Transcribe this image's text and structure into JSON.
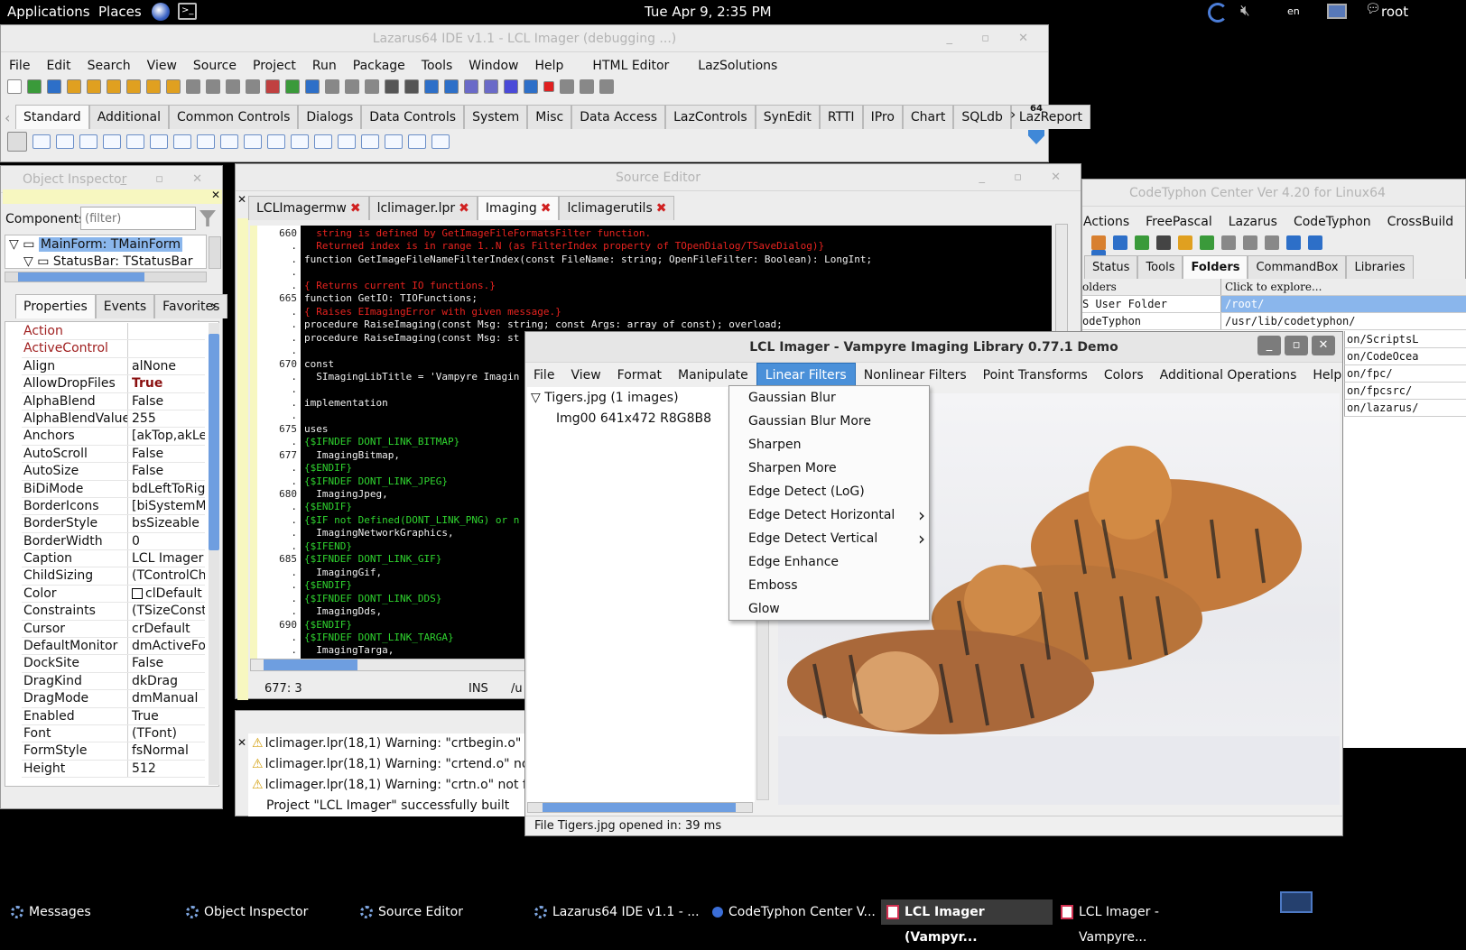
{
  "top_panel": {
    "applications": "Applications",
    "places": "Places",
    "clock": "Tue Apr  9,  2:35 PM",
    "lang": "en",
    "user": "root"
  },
  "ide": {
    "title": "Lazarus64 IDE v1.1 - LCL Imager (debugging ...)",
    "menu": [
      "File",
      "Edit",
      "Search",
      "View",
      "Source",
      "Project",
      "Run",
      "Package",
      "Tools",
      "Window",
      "Help",
      "HTML Editor",
      "LazSolutions"
    ],
    "palette_tabs": [
      "Standard",
      "Additional",
      "Common Controls",
      "Dialogs",
      "Data Controls",
      "System",
      "Misc",
      "Data Access",
      "LazControls",
      "SynEdit",
      "RTTI",
      "IPro",
      "Chart",
      "SQLdb",
      "LazReport"
    ],
    "badge": "64"
  },
  "oi": {
    "title": "Object Inspector",
    "components_label": "Components",
    "filter_placeholder": "(filter)",
    "tree": [
      "MainForm: TMainForm",
      "StatusBar: TStatusBar"
    ],
    "tabs": [
      "Properties",
      "Events",
      "Favorites"
    ],
    "props": [
      {
        "n": "Action",
        "v": "",
        "red": true
      },
      {
        "n": "ActiveControl",
        "v": "",
        "red": true
      },
      {
        "n": "Align",
        "v": "alNone"
      },
      {
        "n": "AllowDropFiles",
        "v": "True",
        "bold": true
      },
      {
        "n": "AlphaBlend",
        "v": "False"
      },
      {
        "n": "AlphaBlendValue",
        "v": "255"
      },
      {
        "n": "Anchors",
        "v": "[akTop,akLef",
        "exp": true
      },
      {
        "n": "AutoScroll",
        "v": "False"
      },
      {
        "n": "AutoSize",
        "v": "False"
      },
      {
        "n": "BiDiMode",
        "v": "bdLeftToRigh"
      },
      {
        "n": "BorderIcons",
        "v": "[biSystemMe",
        "exp": true
      },
      {
        "n": "BorderStyle",
        "v": "bsSizeable"
      },
      {
        "n": "BorderWidth",
        "v": "0"
      },
      {
        "n": "Caption",
        "v": "LCL Imager ("
      },
      {
        "n": "ChildSizing",
        "v": "(TControlCh",
        "exp": true
      },
      {
        "n": "Color",
        "v": "clDefault",
        "swatch": true
      },
      {
        "n": "Constraints",
        "v": "(TSizeConstr",
        "exp": true
      },
      {
        "n": "Cursor",
        "v": "crDefault"
      },
      {
        "n": "DefaultMonitor",
        "v": "dmActiveFor"
      },
      {
        "n": "DockSite",
        "v": "False"
      },
      {
        "n": "DragKind",
        "v": "dkDrag"
      },
      {
        "n": "DragMode",
        "v": "dmManual"
      },
      {
        "n": "Enabled",
        "v": "True"
      },
      {
        "n": "Font",
        "v": "(TFont)",
        "exp": true
      },
      {
        "n": "FormStyle",
        "v": "fsNormal"
      },
      {
        "n": "Height",
        "v": "512"
      }
    ]
  },
  "src": {
    "title": "Source Editor",
    "tabs": [
      "LCLImagermw",
      "lclimager.lpr",
      "Imaging",
      "lclimagerutils"
    ],
    "status": {
      "pos": "677:  3",
      "mode": "INS",
      "path": "/u"
    },
    "lines": [
      {
        "ln": "660",
        "t": "  string is defined by GetImageFileFormatsFilter function.",
        "c": "#e8231f"
      },
      {
        "ln": ".",
        "t": "  Returned index is in range 1..N (as FilterIndex property of TOpenDialog/TSaveDialog)}",
        "c": "#e8231f"
      },
      {
        "ln": ".",
        "t": "function GetImageFileNameFilterIndex(const FileName: string; OpenFileFilter: Boolean): LongInt;",
        "c": "#f0f0f0"
      },
      {
        "ln": ".",
        "t": "",
        "c": "#fff"
      },
      {
        "ln": ".",
        "t": "{ Returns current IO functions.}",
        "c": "#e8231f"
      },
      {
        "ln": "665",
        "t": "function GetIO: TIOFunctions;",
        "c": "#f0f0f0"
      },
      {
        "ln": ".",
        "t": "{ Raises EImagingError with given message.}",
        "c": "#e8231f"
      },
      {
        "ln": ".",
        "t": "procedure RaiseImaging(const Msg: string; const Args: array of const); overload;",
        "c": "#f0f0f0"
      },
      {
        "ln": ".",
        "t": "procedure RaiseImaging(const Msg: st",
        "c": "#f0f0f0"
      },
      {
        "ln": ".",
        "t": "",
        "c": "#fff"
      },
      {
        "ln": "670",
        "t": "const",
        "c": "#f0f0f0"
      },
      {
        "ln": ".",
        "t": "  SImagingLibTitle = 'Vampyre Imagin",
        "c": "#f0f0f0"
      },
      {
        "ln": ".",
        "t": "",
        "c": "#fff"
      },
      {
        "ln": ".",
        "t": "implementation",
        "c": "#f0f0f0"
      },
      {
        "ln": ".",
        "t": "",
        "c": "#fff"
      },
      {
        "ln": "675",
        "t": "uses",
        "c": "#f0f0f0"
      },
      {
        "ln": ".",
        "t": "{$IFNDEF DONT_LINK_BITMAP}",
        "c": "#2fd52f"
      },
      {
        "ln": "677",
        "t": "  ImagingBitmap,",
        "c": "#f0f0f0"
      },
      {
        "ln": ".",
        "t": "{$ENDIF}",
        "c": "#2fd52f"
      },
      {
        "ln": ".",
        "t": "{$IFNDEF DONT_LINK_JPEG}",
        "c": "#2fd52f"
      },
      {
        "ln": "680",
        "t": "  ImagingJpeg,",
        "c": "#f0f0f0"
      },
      {
        "ln": ".",
        "t": "{$ENDIF}",
        "c": "#2fd52f"
      },
      {
        "ln": ".",
        "t": "{$IF not Defined(DONT_LINK_PNG) or n",
        "c": "#2fd52f"
      },
      {
        "ln": ".",
        "t": "  ImagingNetworkGraphics,",
        "c": "#f0f0f0"
      },
      {
        "ln": ".",
        "t": "{$IFEND}",
        "c": "#2fd52f"
      },
      {
        "ln": "685",
        "t": "{$IFNDEF DONT_LINK_GIF}",
        "c": "#2fd52f"
      },
      {
        "ln": ".",
        "t": "  ImagingGif,",
        "c": "#f0f0f0"
      },
      {
        "ln": ".",
        "t": "{$ENDIF}",
        "c": "#2fd52f"
      },
      {
        "ln": ".",
        "t": "{$IFNDEF DONT_LINK_DDS}",
        "c": "#2fd52f"
      },
      {
        "ln": ".",
        "t": "  ImagingDds,",
        "c": "#f0f0f0"
      },
      {
        "ln": "690",
        "t": "{$ENDIF}",
        "c": "#2fd52f"
      },
      {
        "ln": ".",
        "t": "{$IFNDEF DONT_LINK_TARGA}",
        "c": "#2fd52f"
      },
      {
        "ln": ".",
        "t": "  ImagingTarga,",
        "c": "#f0f0f0"
      }
    ]
  },
  "messages": [
    "lclimager.lpr(18,1) Warning: \"crtbegin.o\" not",
    "lclimager.lpr(18,1) Warning: \"crtend.o\" not f",
    "lclimager.lpr(18,1) Warning: \"crtn.o\" not four",
    "Project \"LCL Imager\" successfully built"
  ],
  "ct": {
    "title": "CodeTyphon Center Ver 4.20 for Linux64",
    "menu": [
      "Actions",
      "FreePascal",
      "Lazarus",
      "CodeTyphon",
      "CrossBuild"
    ],
    "tabs": [
      "Status",
      "Tools",
      "Folders",
      "CommandBox",
      "Libraries"
    ],
    "col1": "olders",
    "col2": "Click to explore...",
    "rows": [
      {
        "a": "S User Folder",
        "b": "/root/"
      },
      {
        "a": "odeTyphon",
        "b": "/usr/lib/codetyphon/"
      }
    ],
    "extra": [
      "on/ScriptsL",
      "on/CodeOcea",
      "on/fpc/",
      "on/fpcsrc/",
      "on/lazarus/"
    ]
  },
  "imager": {
    "title": "LCL Imager - Vampyre Imaging Library 0.77.1 Demo",
    "menu": [
      "File",
      "View",
      "Format",
      "Manipulate",
      "Linear Filters",
      "Nonlinear Filters",
      "Point Transforms",
      "Colors",
      "Additional Operations",
      "Help"
    ],
    "tree_root": "Tigers.jpg (1 images)",
    "tree_child": "Img00 641x472 R8G8B8",
    "status": "File Tigers.jpg opened in: 39 ms",
    "filters": [
      {
        "l": "Gaussian Blur"
      },
      {
        "l": "Gaussian Blur More"
      },
      {
        "l": "Sharpen"
      },
      {
        "l": "Sharpen More"
      },
      {
        "l": "Edge Detect (LoG)"
      },
      {
        "l": "Edge Detect Horizontal",
        "sub": true
      },
      {
        "l": "Edge Detect Vertical",
        "sub": true
      },
      {
        "l": "Edge Enhance"
      },
      {
        "l": "Emboss"
      },
      {
        "l": "Glow"
      }
    ]
  },
  "taskbar": [
    {
      "l": "Messages"
    },
    {
      "l": "Object Inspector"
    },
    {
      "l": "Source Editor"
    },
    {
      "l": "Lazarus64 IDE v1.1 - ..."
    },
    {
      "l": "CodeTyphon Center V..."
    },
    {
      "l": "LCL Imager (Vampyr...",
      "sel": true
    },
    {
      "l": "LCL Imager - Vampyre..."
    }
  ]
}
